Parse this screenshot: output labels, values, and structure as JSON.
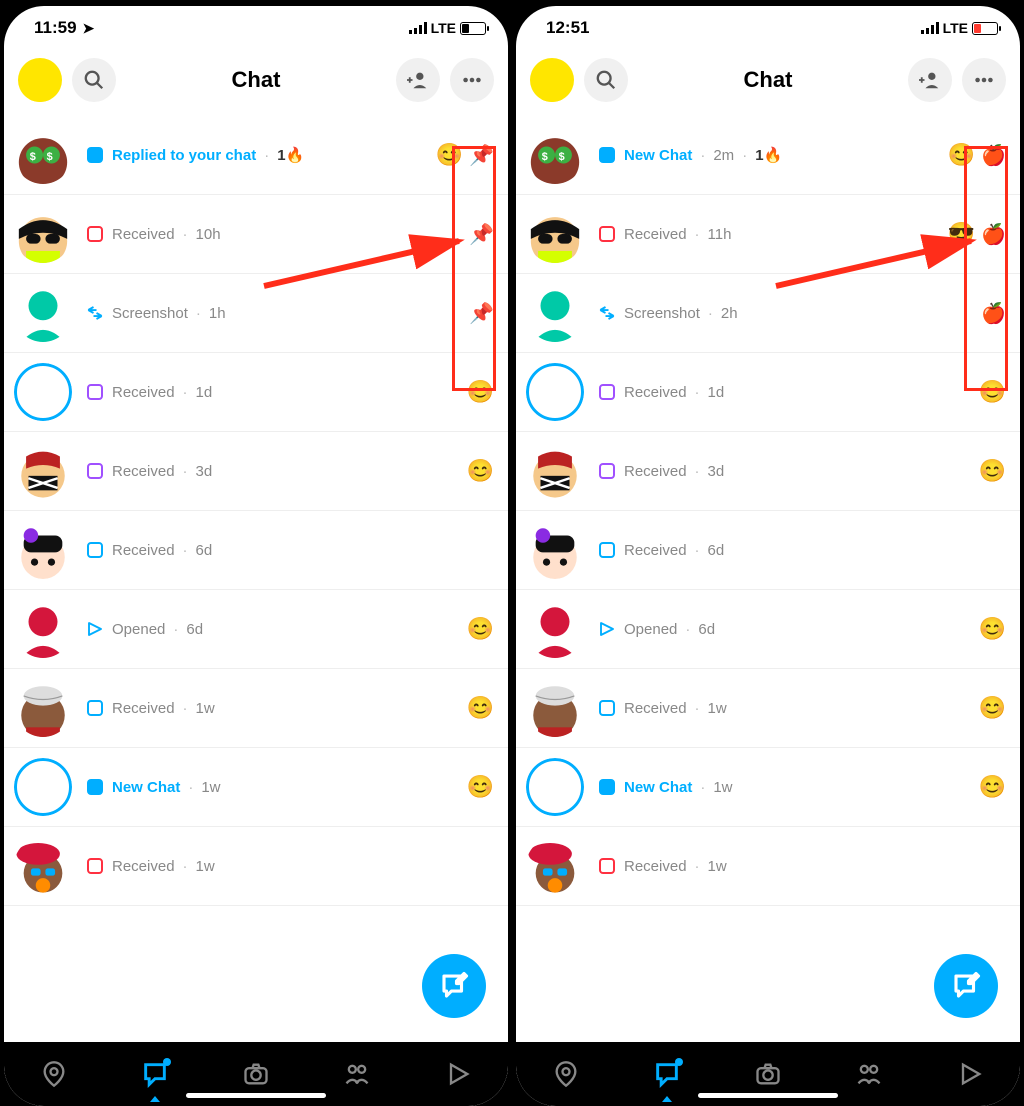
{
  "screens": [
    {
      "statusbar": {
        "time": "11:59",
        "location_icon": true,
        "network": "LTE",
        "battery_low": false
      },
      "header": {
        "title": "Chat"
      },
      "pin_emoji": "📌",
      "chats": [
        {
          "status_type": "blue-fill",
          "status": "Replied to your chat",
          "time": "",
          "highlight": true,
          "streak": "1",
          "streak_emoji": "🔥",
          "right_emoji": "😊",
          "pinned": true,
          "avatar": "money"
        },
        {
          "status_type": "red-outline",
          "status": "Received",
          "time": "10h",
          "highlight": false,
          "right_emoji": "",
          "pinned": true,
          "avatar": "shades"
        },
        {
          "status_type": "arrows",
          "status": "Screenshot",
          "time": "1h",
          "highlight": false,
          "right_emoji": "",
          "pinned": true,
          "avatar": "teal"
        },
        {
          "status_type": "purple-outline",
          "status": "Received",
          "time": "1d",
          "highlight": false,
          "right_emoji": "😊",
          "pinned": false,
          "avatar": "ring"
        },
        {
          "status_type": "purple-outline",
          "status": "Received",
          "time": "3d",
          "highlight": false,
          "right_emoji": "😊",
          "pinned": false,
          "avatar": "keffiyeh"
        },
        {
          "status_type": "blue-outline",
          "status": "Received",
          "time": "6d",
          "highlight": false,
          "right_emoji": "",
          "pinned": false,
          "avatar": "bow"
        },
        {
          "status_type": "triangle",
          "status": "Opened",
          "time": "6d",
          "highlight": false,
          "right_emoji": "😊",
          "pinned": false,
          "avatar": "red"
        },
        {
          "status_type": "blue-outline",
          "status": "Received",
          "time": "1w",
          "highlight": false,
          "right_emoji": "😊",
          "pinned": false,
          "avatar": "kufi"
        },
        {
          "status_type": "blue-fill",
          "status": "New Chat",
          "time": "1w",
          "highlight": true,
          "right_emoji": "😊",
          "pinned": false,
          "avatar": "ring"
        },
        {
          "status_type": "red-outline",
          "status": "Received",
          "time": "1w",
          "highlight": false,
          "right_emoji": "",
          "pinned": false,
          "avatar": "beret"
        }
      ]
    },
    {
      "statusbar": {
        "time": "12:51",
        "location_icon": false,
        "network": "LTE",
        "battery_low": true
      },
      "header": {
        "title": "Chat"
      },
      "pin_emoji": "🍎",
      "chats": [
        {
          "status_type": "blue-fill",
          "status": "New Chat",
          "time": "2m",
          "highlight": true,
          "streak": "1",
          "streak_emoji": "🔥",
          "right_emoji": "😊",
          "pinned": true,
          "avatar": "money"
        },
        {
          "status_type": "red-outline",
          "status": "Received",
          "time": "11h",
          "highlight": false,
          "right_emoji": "😎",
          "pinned": true,
          "avatar": "shades"
        },
        {
          "status_type": "arrows",
          "status": "Screenshot",
          "time": "2h",
          "highlight": false,
          "right_emoji": "",
          "pinned": true,
          "avatar": "teal"
        },
        {
          "status_type": "purple-outline",
          "status": "Received",
          "time": "1d",
          "highlight": false,
          "right_emoji": "😊",
          "pinned": false,
          "avatar": "ring"
        },
        {
          "status_type": "purple-outline",
          "status": "Received",
          "time": "3d",
          "highlight": false,
          "right_emoji": "😊",
          "pinned": false,
          "avatar": "keffiyeh"
        },
        {
          "status_type": "blue-outline",
          "status": "Received",
          "time": "6d",
          "highlight": false,
          "right_emoji": "",
          "pinned": false,
          "avatar": "bow"
        },
        {
          "status_type": "triangle",
          "status": "Opened",
          "time": "6d",
          "highlight": false,
          "right_emoji": "😊",
          "pinned": false,
          "avatar": "red"
        },
        {
          "status_type": "blue-outline",
          "status": "Received",
          "time": "1w",
          "highlight": false,
          "right_emoji": "😊",
          "pinned": false,
          "avatar": "kufi"
        },
        {
          "status_type": "blue-fill",
          "status": "New Chat",
          "time": "1w",
          "highlight": true,
          "right_emoji": "😊",
          "pinned": false,
          "avatar": "ring"
        },
        {
          "status_type": "red-outline",
          "status": "Received",
          "time": "1w",
          "highlight": false,
          "right_emoji": "",
          "pinned": false,
          "avatar": "beret"
        }
      ]
    }
  ]
}
